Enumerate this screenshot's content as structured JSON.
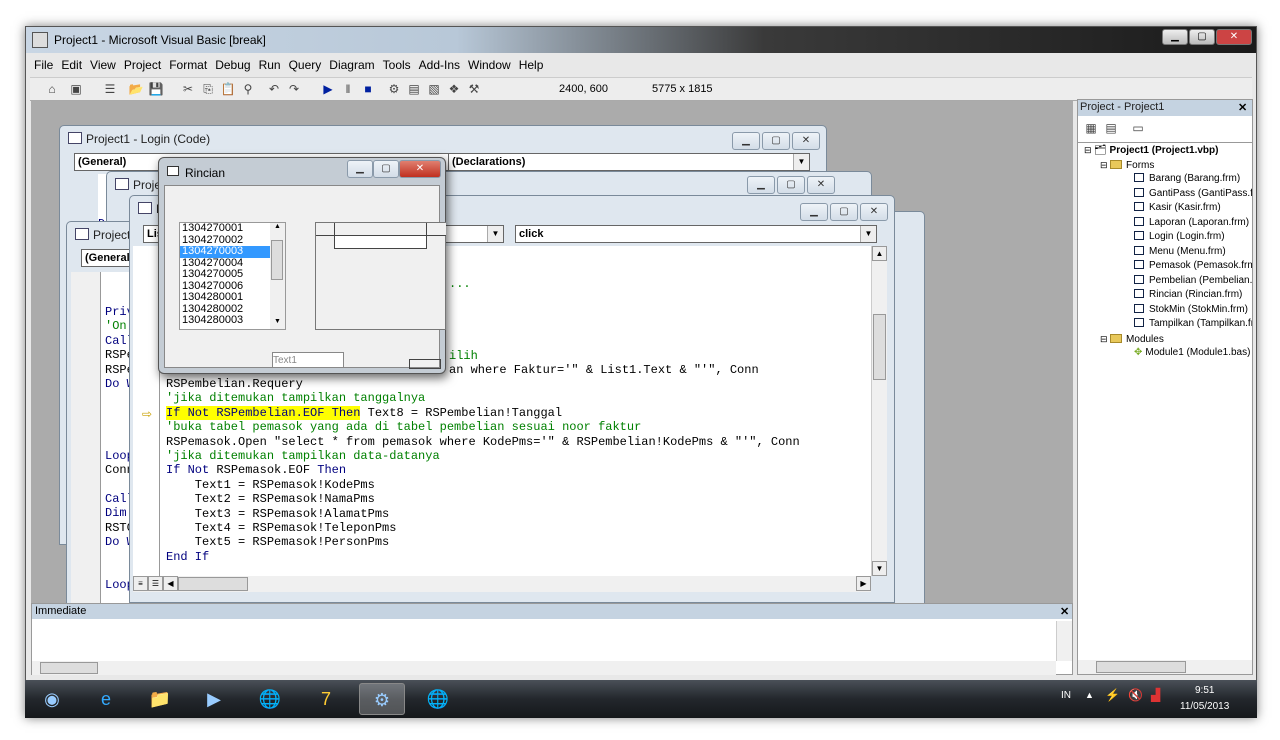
{
  "window": {
    "title": "Project1 - Microsoft Visual Basic [break]",
    "min": "▁",
    "max": "▢",
    "close": "✕"
  },
  "menu": [
    "File",
    "Edit",
    "View",
    "Project",
    "Format",
    "Debug",
    "Run",
    "Query",
    "Diagram",
    "Tools",
    "Add-Ins",
    "Window",
    "Help"
  ],
  "toolbar": {
    "position": "2400, 600",
    "size": "5775 x 1815",
    "icons": [
      "add-project-icon",
      "add-form-icon",
      "menu-editor-icon",
      "open-icon",
      "save-icon",
      "cut-icon",
      "copy-icon",
      "paste-icon",
      "find-icon",
      "undo-icon",
      "redo-icon",
      "run-icon",
      "break-icon",
      "stop-icon",
      "project-explorer-icon",
      "properties-icon",
      "form-layout-icon",
      "object-browser-icon",
      "toolbox-icon"
    ]
  },
  "login_window": {
    "title": "Project1 - Login (Code)",
    "object": "(General)",
    "procedure": "(Declarations)",
    "code": [
      "D",
      "D"
    ]
  },
  "mid_window": {
    "title": "Projec"
  },
  "left_window": {
    "title": "Project1",
    "object": "(General",
    "code": [
      {
        "t": "Priv",
        "c": "kw"
      },
      {
        "t": "'On",
        "c": "cm"
      },
      {
        "t": "Call",
        "c": "kw"
      },
      {
        "t": "RSPe",
        "c": "tx"
      },
      {
        "t": "RSPe",
        "c": "tx"
      },
      {
        "t": "Do W",
        "c": "kw"
      },
      {
        "t": "",
        "c": "tx"
      },
      {
        "t": "",
        "c": "tx"
      },
      {
        "t": "",
        "c": "tx"
      },
      {
        "t": "",
        "c": "tx"
      },
      {
        "t": "Loop",
        "c": "kw"
      },
      {
        "t": "Conn",
        "c": "tx"
      },
      {
        "t": "",
        "c": "tx"
      },
      {
        "t": "Call",
        "c": "kw"
      },
      {
        "t": "Dim",
        "c": "kw"
      },
      {
        "t": "RSTC",
        "c": "tx"
      },
      {
        "t": "Do W",
        "c": "kw"
      },
      {
        "t": "",
        "c": "tx"
      },
      {
        "t": "",
        "c": "tx"
      },
      {
        "t": "Loop",
        "c": "kw"
      }
    ]
  },
  "main_window": {
    "title": "P",
    "object": "List1",
    "procedure": "click",
    "partial": {
      "l1": "...",
      "l2": "ilih",
      "l3": "an where Faktur='\" & List1.Text & \"'\", Conn"
    },
    "code": [
      {
        "parts": [
          {
            "t": "RSPembelian.Requery",
            "c": "tx"
          }
        ]
      },
      {
        "parts": [
          {
            "t": "'jika ditemukan tampilkan tanggalnya",
            "c": "cm"
          }
        ]
      },
      {
        "parts": [
          {
            "t": "If Not RSPembelian.EOF Then",
            "c": "kw hl"
          },
          {
            "t": " Text8 = RSPembelian!Tanggal",
            "c": "tx"
          }
        ],
        "current": true
      },
      {
        "parts": [
          {
            "t": "'buka tabel pemasok yang ada di tabel pembelian sesuai noor faktur",
            "c": "cm"
          }
        ]
      },
      {
        "parts": [
          {
            "t": "RSPemasok.Open \"select * from pemasok where KodePms='\" & RSPembelian!KodePms & \"'\", Conn",
            "c": "tx"
          }
        ]
      },
      {
        "parts": [
          {
            "t": "'jika ditemukan tampilkan data-datanya",
            "c": "cm"
          }
        ]
      },
      {
        "parts": [
          {
            "t": "If Not",
            "c": "kw"
          },
          {
            "t": " RSPemasok.EOF ",
            "c": "tx"
          },
          {
            "t": "Then",
            "c": "kw"
          }
        ]
      },
      {
        "parts": [
          {
            "t": "    Text1 = RSPemasok!KodePms",
            "c": "tx"
          }
        ]
      },
      {
        "parts": [
          {
            "t": "    Text2 = RSPemasok!NamaPms",
            "c": "tx"
          }
        ]
      },
      {
        "parts": [
          {
            "t": "    Text3 = RSPemasok!AlamatPms",
            "c": "tx"
          }
        ]
      },
      {
        "parts": [
          {
            "t": "    Text4 = RSPemasok!TeleponPms",
            "c": "tx"
          }
        ]
      },
      {
        "parts": [
          {
            "t": "    Text5 = RSPemasok!PersonPms",
            "c": "tx"
          }
        ]
      },
      {
        "parts": [
          {
            "t": "End If",
            "c": "kw"
          }
        ]
      }
    ]
  },
  "rincian": {
    "title": "Rincian",
    "list": [
      "1304270001",
      "1304270002",
      "1304270003",
      "1304270004",
      "1304270005",
      "1304270006",
      "1304280001",
      "1304280002",
      "1304280003"
    ],
    "selected_index": 2,
    "text1": "Text1"
  },
  "project": {
    "title": "Project - Project1",
    "root": "Project1 (Project1.vbp)",
    "forms_label": "Forms",
    "forms": [
      "Barang (Barang.frm)",
      "GantiPass (GantiPass.frm)",
      "Kasir (Kasir.frm)",
      "Laporan (Laporan.frm)",
      "Login (Login.frm)",
      "Menu (Menu.frm)",
      "Pemasok (Pemasok.frm)",
      "Pembelian (Pembelian.frm)",
      "Rincian (Rincian.frm)",
      "StokMin (StokMin.frm)",
      "Tampilkan (Tampilkan.frm)"
    ],
    "modules_label": "Modules",
    "modules": [
      "Module1 (Module1.bas)"
    ]
  },
  "immediate": {
    "title": "Immediate"
  },
  "taskbar": {
    "apps": [
      "start-orb-icon",
      "internet-explorer-icon",
      "explorer-icon",
      "media-player-icon",
      "globe-app-icon",
      "app-7-icon",
      "visual-basic-icon",
      "globe-app-icon"
    ],
    "active_index": 6,
    "lang": "IN",
    "time": "9:51",
    "date": "11/05/2013"
  },
  "colors": {
    "keyword": "#00007f",
    "comment": "#008000",
    "highlight": "#ffff00",
    "selection": "#3399ff"
  }
}
